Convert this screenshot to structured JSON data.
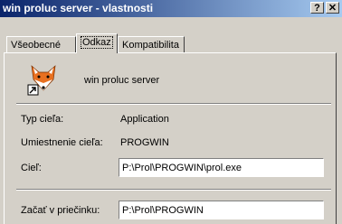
{
  "window": {
    "title": "win proluc server - vlastnosti",
    "help_glyph": "?",
    "close_glyph": "✕"
  },
  "tabs": [
    {
      "label": "Všeobecné",
      "active": false
    },
    {
      "label": "Odkaz",
      "active": true
    },
    {
      "label": "Kompatibilita",
      "active": false
    }
  ],
  "shortcut": {
    "icon": "fox-shortcut-icon",
    "name": "win proluc server"
  },
  "fields": {
    "target_type": {
      "label": "Typ cieľa:",
      "value": "Application"
    },
    "target_location": {
      "label": "Umiestnenie cieľa:",
      "value": "PROGWIN"
    },
    "target": {
      "label": "Cieľ:",
      "value": "P:\\Prol\\PROGWIN\\prol.exe"
    },
    "start_in": {
      "label": "Začať v priečinku:",
      "value": "P:\\Prol\\PROGWIN"
    }
  }
}
